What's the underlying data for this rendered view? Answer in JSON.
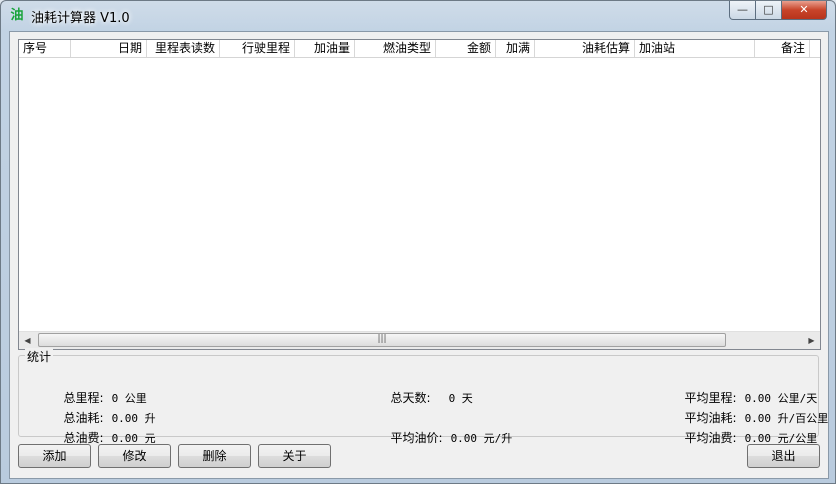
{
  "window": {
    "title": "油耗计算器 V1.0",
    "icon_glyph": "油"
  },
  "caption": {
    "min": "—",
    "max": "□",
    "close": "✕"
  },
  "columns": [
    "序号",
    "日期",
    "里程表读数",
    "行驶里程",
    "加油量",
    "燃油类型",
    "金额",
    "加满",
    "油耗估算",
    "加油站",
    "备注"
  ],
  "stats": {
    "title": "统计",
    "total_distance_label": "总里程:",
    "total_distance_value": "0 公里",
    "total_fuel_label": "总油耗:",
    "total_fuel_value": "0.00 升",
    "total_cost_label": "总油费:",
    "total_cost_value": "0.00 元",
    "total_days_label": "总天数:",
    "total_days_value": "0 天",
    "avg_price_label": "平均油价:",
    "avg_price_value": "0.00 元/升",
    "avg_distance_label": "平均里程:",
    "avg_distance_value": "0.00 公里/天",
    "avg_consumption_label": "平均油耗:",
    "avg_consumption_value": "0.00 升/百公里",
    "avg_cost_label": "平均油费:",
    "avg_cost_value": "0.00 元/公里"
  },
  "buttons": {
    "add": "添加",
    "edit": "修改",
    "delete": "删除",
    "about": "关于",
    "exit": "退出"
  },
  "scrollbar": {
    "left_arrow": "◀",
    "right_arrow": "▶",
    "grip": "|||"
  }
}
